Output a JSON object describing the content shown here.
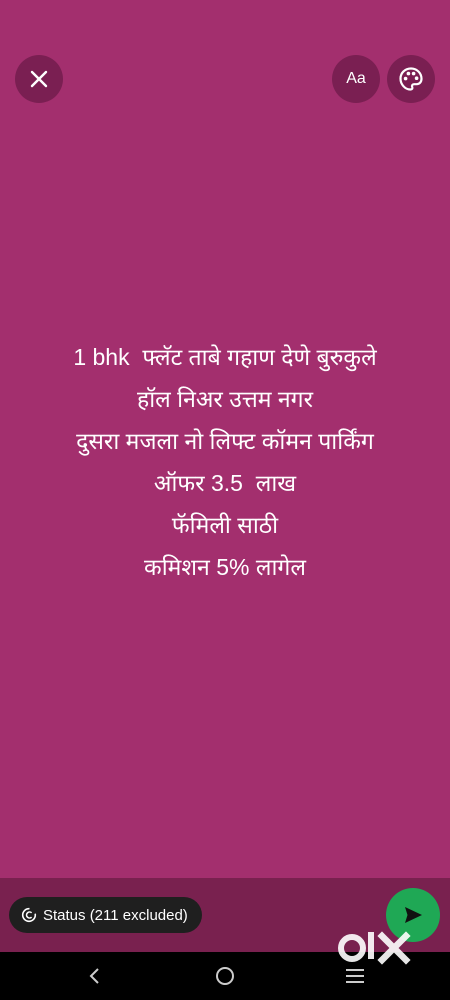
{
  "status_text": {
    "lines": [
      "1 bhk  फ्लॅट ताबे गहाण देणे बुरुकुले",
      "हॉल निअर उत्तम नगर",
      "दुसरा मजला नो लिफ्ट कॉमन पार्किंग",
      "ऑफर 3.5  लाख",
      "फॅमिली साठी",
      "कमिशन 5% लागेल"
    ]
  },
  "toolbar": {
    "font_label": "Aa"
  },
  "audience": {
    "label": "Status (211 excluded)"
  },
  "watermark": {
    "text": "olx"
  },
  "colors": {
    "background": "#a32f6e",
    "button_bg": "#7a1f52",
    "bottom_bar": "#79214f",
    "send": "#1fa855"
  }
}
